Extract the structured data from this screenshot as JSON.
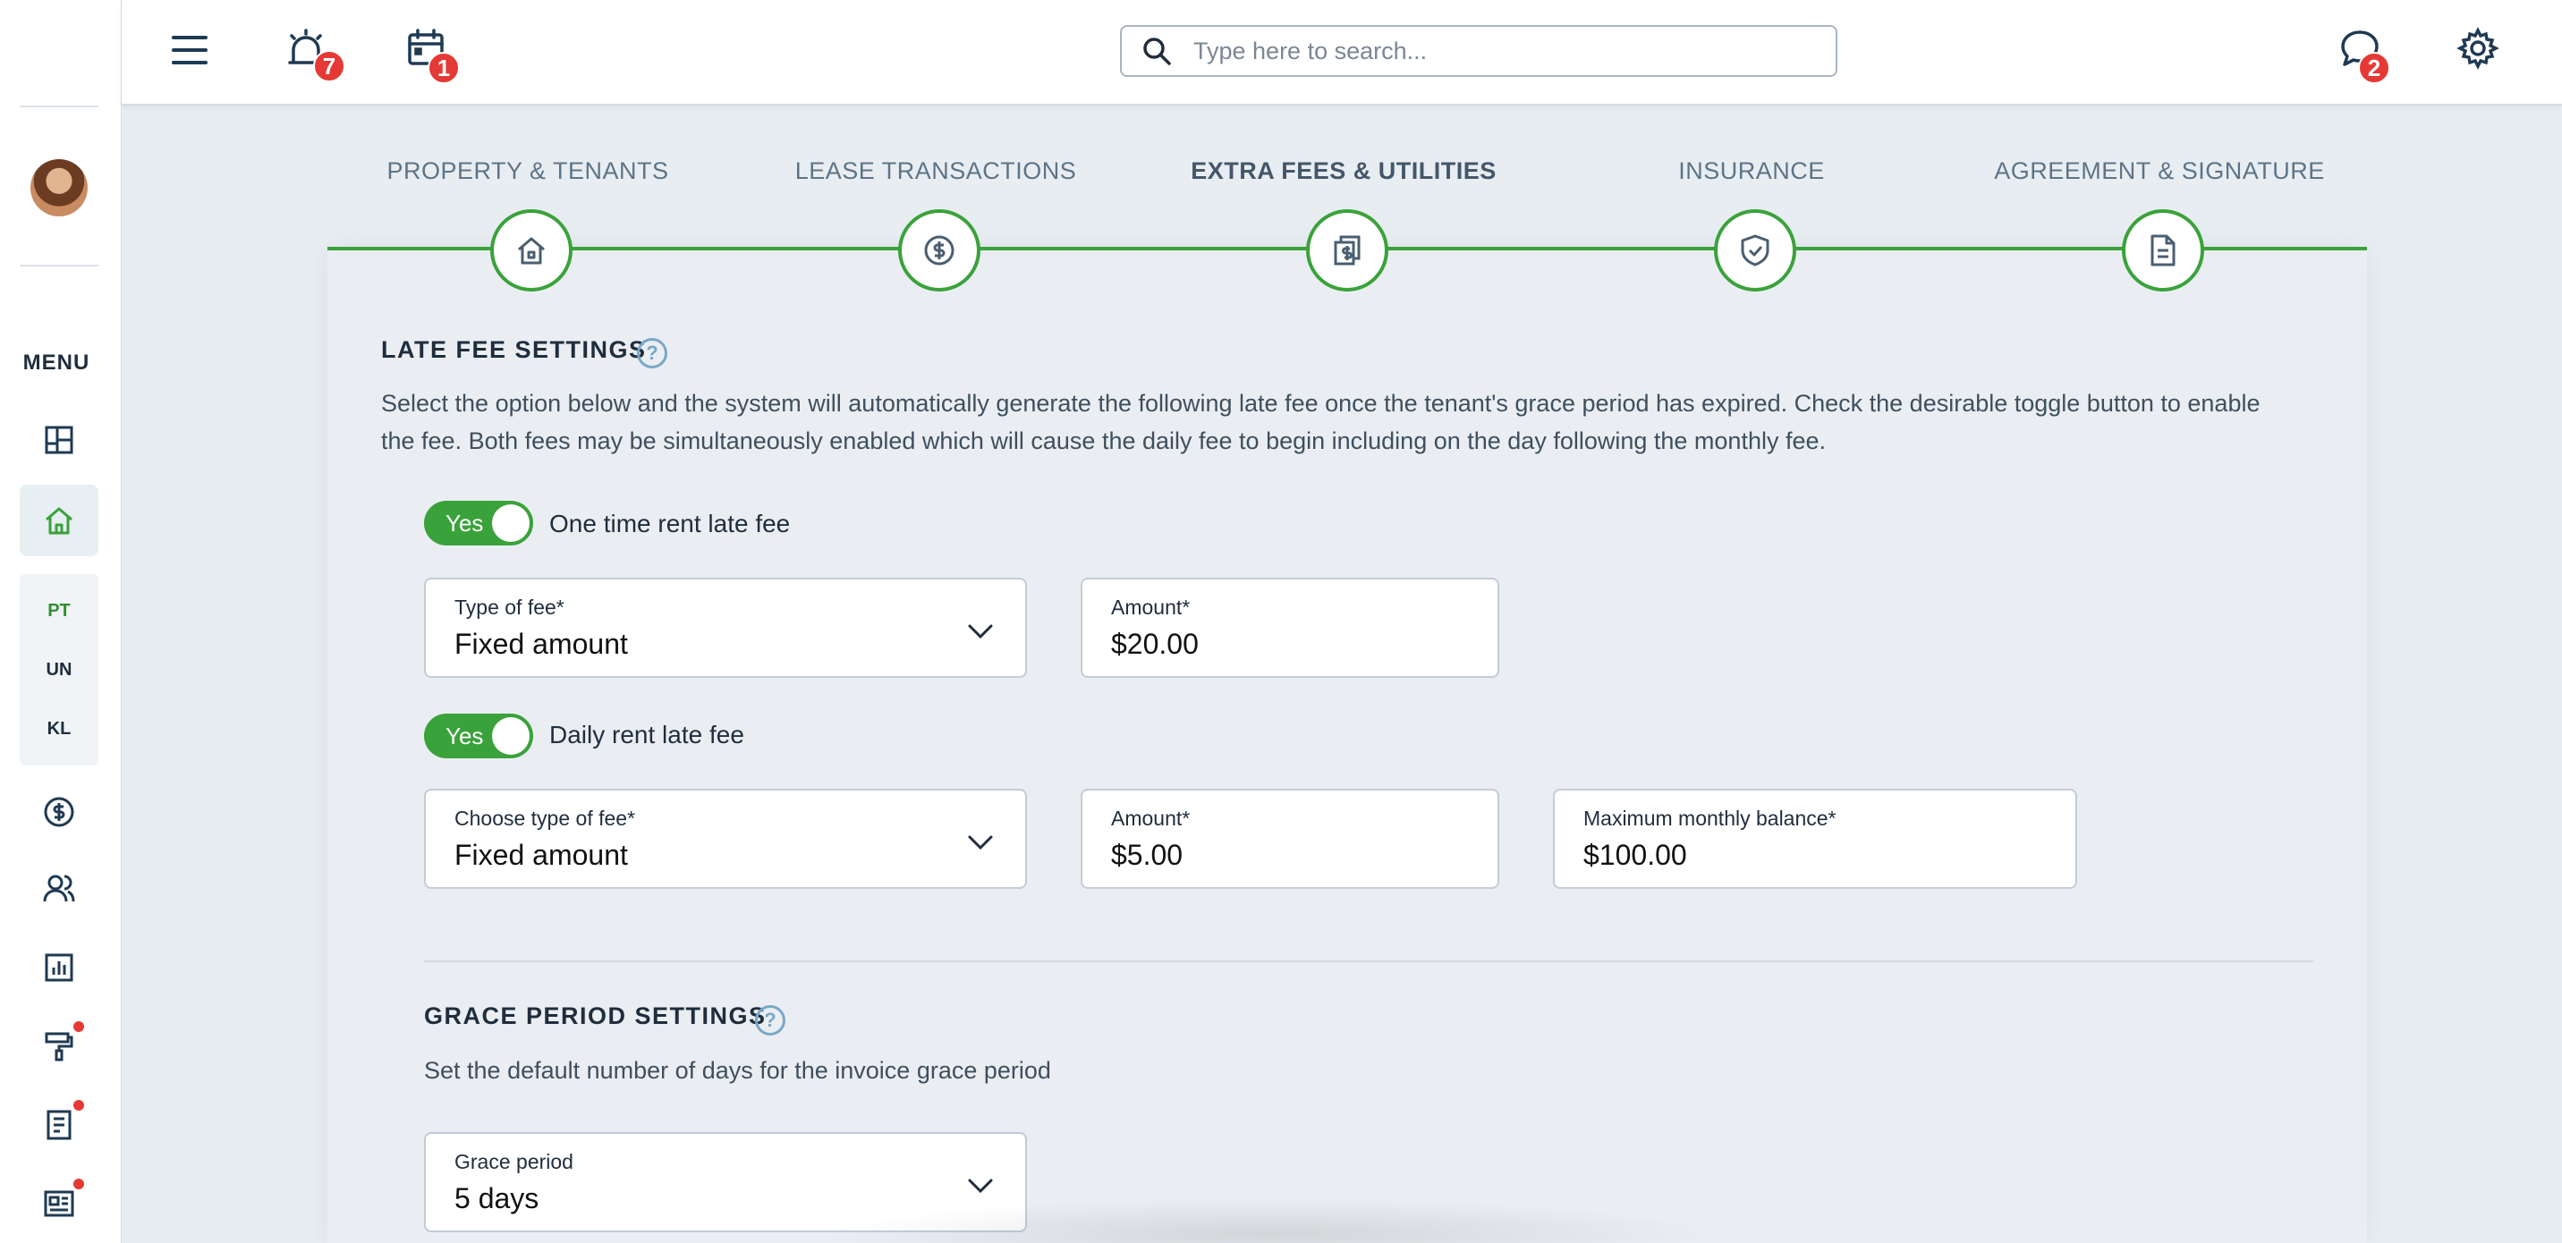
{
  "sidebar": {
    "menu_label": "MENU",
    "abbrs": [
      "PT",
      "UN",
      "KL"
    ],
    "icons": [
      "dashboard-icon",
      "home-icon",
      "dollar-icon",
      "users-icon",
      "report-icon",
      "paint-roller-icon",
      "document-icon",
      "newspaper-icon"
    ]
  },
  "topbar": {
    "alarm_badge": "7",
    "calendar_badge": "1",
    "chat_badge": "2",
    "search_placeholder": "Type here to search..."
  },
  "stepper": {
    "steps": [
      {
        "label": "PROPERTY & TENANTS",
        "icon": "house-icon"
      },
      {
        "label": "LEASE TRANSACTIONS",
        "icon": "dollar-icon"
      },
      {
        "label": "EXTRA FEES & UTILITIES",
        "icon": "bills-icon"
      },
      {
        "label": "INSURANCE",
        "icon": "shield-icon"
      },
      {
        "label": "AGREEMENT & SIGNATURE",
        "icon": "document-icon"
      }
    ],
    "active_index": 2
  },
  "late_fee": {
    "title": "LATE FEE SETTINGS",
    "description": "Select the option below and the system will automatically generate the following late fee once the tenant's grace period has expired. Check the desirable toggle button to enable the fee. Both fees may be simultaneously enabled which will cause the daily fee to begin including on the day following the monthly fee.",
    "one_time": {
      "toggle_text": "Yes",
      "label": "One time rent late fee",
      "type_label": "Type of fee*",
      "type_value": "Fixed amount",
      "amount_label": "Amount*",
      "amount_value": "$20.00"
    },
    "daily": {
      "toggle_text": "Yes",
      "label": "Daily rent late fee",
      "type_label": "Choose type of fee*",
      "type_value": "Fixed amount",
      "amount_label": "Amount*",
      "amount_value": "$5.00",
      "max_label": "Maximum monthly balance*",
      "max_value": "$100.00"
    }
  },
  "grace": {
    "title": "GRACE PERIOD SETTINGS",
    "description": "Set the default number of days for the invoice grace period",
    "field_label": "Grace period",
    "field_value": "5 days"
  },
  "colors": {
    "accent_green": "#3aa23a",
    "badge_red": "#e53935",
    "background": "#e8edf2"
  }
}
